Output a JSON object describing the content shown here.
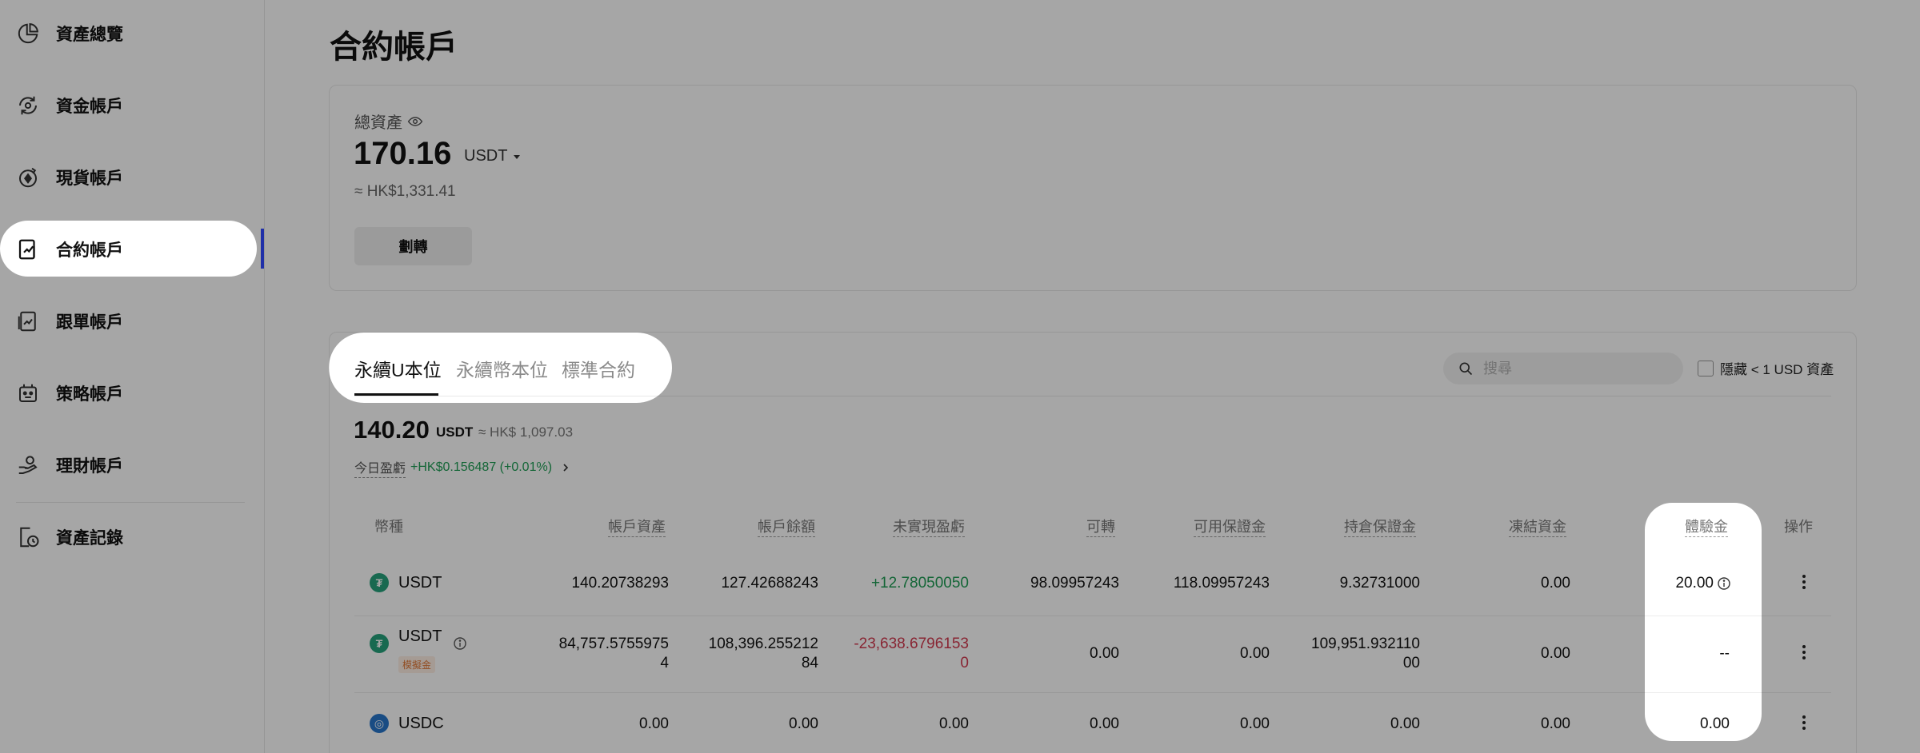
{
  "sidebar": {
    "items": [
      {
        "label": "資產總覽",
        "icon": "pie-chart-icon"
      },
      {
        "label": "資金帳戶",
        "icon": "fund-cycle-icon"
      },
      {
        "label": "現貨帳戶",
        "icon": "spot-coin-icon"
      },
      {
        "label": "合約帳戶",
        "icon": "contract-chart-icon",
        "active": true
      },
      {
        "label": "跟單帳戶",
        "icon": "copy-trade-icon"
      },
      {
        "label": "策略帳戶",
        "icon": "bot-icon"
      },
      {
        "label": "理財帳戶",
        "icon": "hand-coin-icon"
      },
      {
        "label": "資產記錄",
        "icon": "record-clock-icon"
      }
    ]
  },
  "page": {
    "title": "合約帳戶"
  },
  "total": {
    "label": "總資產",
    "value": "170.16",
    "unit": "USDT",
    "approx": "≈ HK$1,331.41",
    "transfer_label": "劃轉"
  },
  "tabs": [
    "永續U本位",
    "永續幣本位",
    "標準合約"
  ],
  "search": {
    "placeholder": "搜尋"
  },
  "hide_small_label": "隱藏 < 1 USD 資產",
  "sub": {
    "value": "140.20",
    "unit": "USDT",
    "approx": "≈ HK$ 1,097.03"
  },
  "pnl": {
    "label": "今日盈虧",
    "value": "+HK$0.156487 (+0.01%)"
  },
  "table": {
    "headers": [
      "幣種",
      "帳戶資產",
      "帳戶餘額",
      "未實現盈虧",
      "可轉",
      "可用保證金",
      "持倉保證金",
      "凍結資金",
      "體驗金",
      "操作"
    ],
    "rows": [
      {
        "coin": "USDT",
        "account_assets": "140.20738293",
        "balance": "127.42688243",
        "unrealized_pnl": "+12.78050050",
        "transferable": "98.09957243",
        "available_margin": "118.09957243",
        "position_margin": "9.32731000",
        "frozen": "0.00",
        "trial_fund": "20.00"
      },
      {
        "coin": "USDT",
        "badge": "模擬金",
        "account_assets": [
          "84,757.5755975",
          "4"
        ],
        "balance": [
          "108,396.255212",
          "84"
        ],
        "unrealized_pnl": [
          "-23,638.6796153",
          "0"
        ],
        "transferable": "0.00",
        "available_margin": "0.00",
        "position_margin": [
          "109,951.932110",
          "00"
        ],
        "frozen": "0.00",
        "trial_fund": "--"
      },
      {
        "coin": "USDC",
        "account_assets": "0.00",
        "balance": "0.00",
        "unrealized_pnl": "0.00",
        "transferable": "0.00",
        "available_margin": "0.00",
        "position_margin": "0.00",
        "frozen": "0.00",
        "trial_fund": "0.00"
      }
    ]
  },
  "colors": {
    "accent": "#1f2fa8",
    "positive": "#1f9d55",
    "negative": "#d23a4f",
    "tether": "#26a17b",
    "usdc": "#2775ca",
    "overlay": "rgba(0,0,0,0.35)"
  }
}
